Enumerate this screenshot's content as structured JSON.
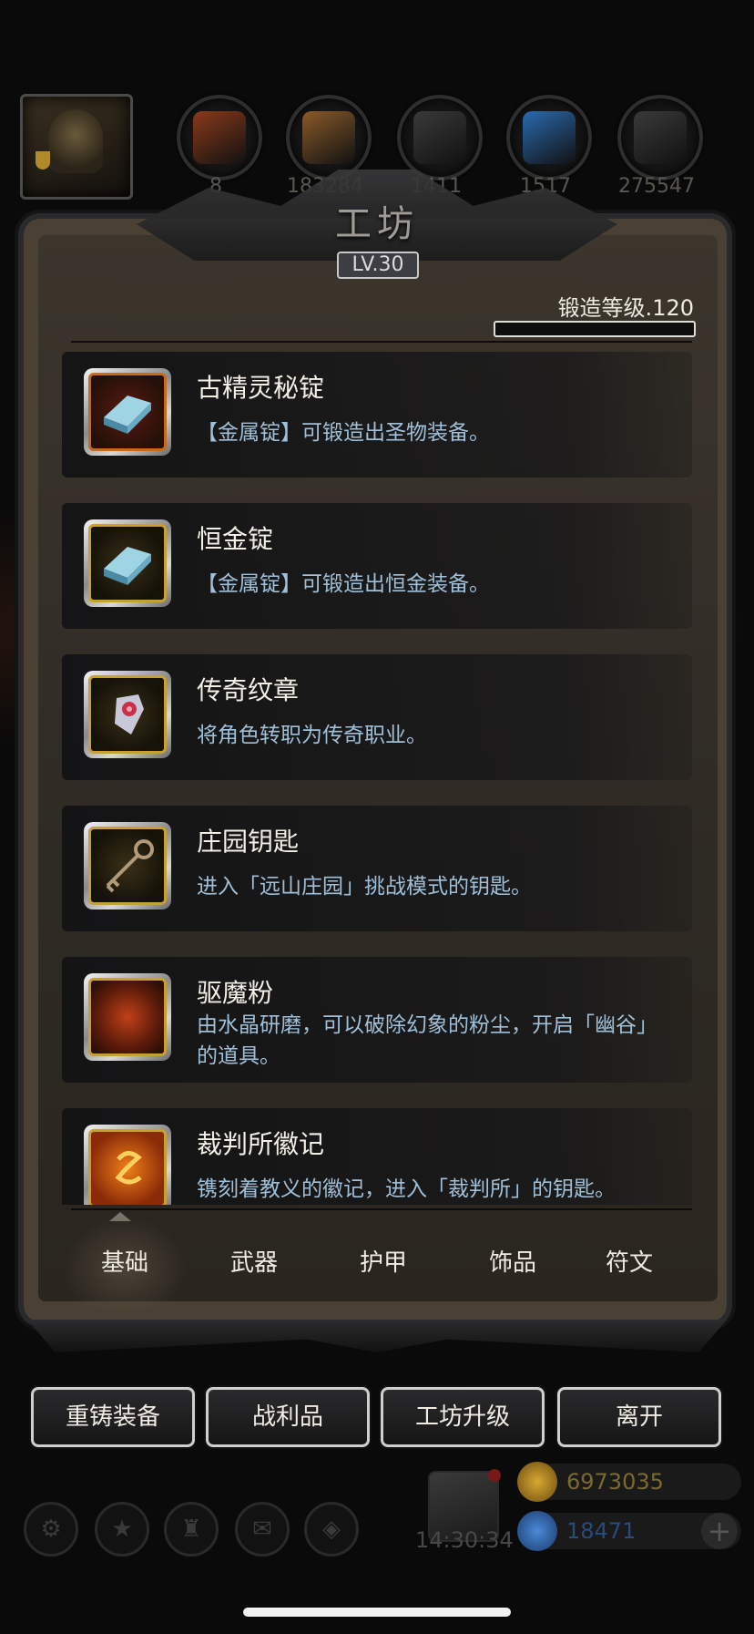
{
  "header": {
    "title": "工坊",
    "level": "LV.30",
    "resources": [
      {
        "icon": "leather-icon",
        "value": "8",
        "color": "#8a3a1a"
      },
      {
        "icon": "wood-icon",
        "value": "183284",
        "color": "#8a5a2a"
      },
      {
        "icon": "iron-icon",
        "value": "1411",
        "color": "#3a3a3a"
      },
      {
        "icon": "crystal-icon",
        "value": "1517",
        "color": "#2a6ab0"
      },
      {
        "icon": "ore-icon",
        "value": "275547",
        "color": "#3a3a3a"
      }
    ]
  },
  "forge": {
    "label": "锻造等级.120",
    "progress": 0.0
  },
  "items": [
    {
      "name": "古精灵秘锭",
      "desc": "【金属锭】可锻造出圣物装备。",
      "icon": "ingot-icon",
      "frame": "red"
    },
    {
      "name": "恒金锭",
      "desc": "【金属锭】可锻造出恒金装备。",
      "icon": "ingot-icon",
      "frame": "gold"
    },
    {
      "name": "传奇纹章",
      "desc": "将角色转职为传奇职业。",
      "icon": "emblem-icon",
      "frame": "gold"
    },
    {
      "name": "庄园钥匙",
      "desc": "进入「远山庄园」挑战模式的钥匙。",
      "icon": "key-icon",
      "frame": "gold"
    },
    {
      "name": "驱魔粉",
      "desc": "由水晶研磨，可以破除幻象的粉尘，开启「幽谷」的道具。",
      "icon": "powder-icon",
      "frame": "gold"
    },
    {
      "name": "裁判所徽记",
      "desc": "镌刻着教义的徽记，进入「裁判所」的钥匙。",
      "icon": "seal-icon",
      "frame": "gold"
    }
  ],
  "tabs": [
    "基础",
    "武器",
    "护甲",
    "饰品",
    "符文"
  ],
  "actions": [
    "重铸装备",
    "战利品",
    "工坊升级",
    "离开"
  ],
  "hud": {
    "time": "14:30:34",
    "gold": "6973035",
    "gems": "18471",
    "plus": "+"
  },
  "colors": {
    "gold": "#c8a030",
    "accent_text": "#9fc0d8"
  }
}
